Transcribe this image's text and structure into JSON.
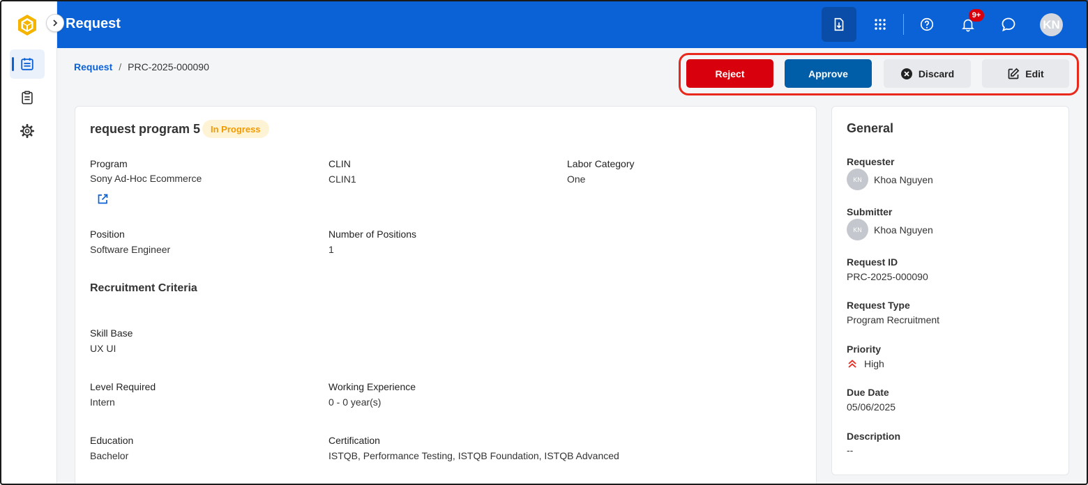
{
  "header": {
    "title": "Request",
    "notification_count": "9+",
    "user_initials": "KN"
  },
  "breadcrumb": {
    "parent": "Request",
    "separator": "/",
    "current": "PRC-2025-000090"
  },
  "actions": {
    "reject": "Reject",
    "approve": "Approve",
    "discard": "Discard",
    "edit": "Edit"
  },
  "request": {
    "title": "request program 5",
    "status": "In Progress",
    "fields": {
      "program": {
        "label": "Program",
        "value": "Sony Ad-Hoc Ecommerce"
      },
      "clin": {
        "label": "CLIN",
        "value": "CLIN1"
      },
      "labor_category": {
        "label": "Labor Category",
        "value": "One"
      },
      "position": {
        "label": "Position",
        "value": "Software Engineer"
      },
      "number_of_positions": {
        "label": "Number of Positions",
        "value": "1"
      }
    },
    "criteria_title": "Recruitment Criteria",
    "criteria": {
      "skill_base": {
        "label": "Skill Base",
        "value": "UX UI"
      },
      "level_required": {
        "label": "Level Required",
        "value": "Intern"
      },
      "working_experience": {
        "label": "Working Experience",
        "value": "0 - 0 year(s)"
      },
      "education": {
        "label": "Education",
        "value": "Bachelor"
      },
      "certification": {
        "label": "Certification",
        "value": "ISTQB, Performance Testing, ISTQB Foundation, ISTQB Advanced"
      }
    }
  },
  "general": {
    "title": "General",
    "requester": {
      "label": "Requester",
      "initials": "KN",
      "name": "Khoa Nguyen"
    },
    "submitter": {
      "label": "Submitter",
      "initials": "KN",
      "name": "Khoa Nguyen"
    },
    "request_id": {
      "label": "Request ID",
      "value": "PRC-2025-000090"
    },
    "request_type": {
      "label": "Request Type",
      "value": "Program Recruitment"
    },
    "priority": {
      "label": "Priority",
      "value": "High"
    },
    "due_date": {
      "label": "Due Date",
      "value": "05/06/2025"
    },
    "description": {
      "label": "Description",
      "value": "--"
    }
  },
  "colors": {
    "brand": "#0b62d6",
    "reject": "#d8000c",
    "approve": "#005da8",
    "status_bg": "#fff3d6",
    "status_text": "#f29a00",
    "highlight": "#e8291c"
  },
  "icons": [
    "logo-icon",
    "requests-icon",
    "clipboard-icon",
    "gear-icon",
    "chevron-right-icon",
    "download-icon",
    "apps-grid-icon",
    "help-icon",
    "bell-icon",
    "chat-icon",
    "external-link-icon",
    "close-circle-icon",
    "edit-icon",
    "priority-high-icon"
  ]
}
